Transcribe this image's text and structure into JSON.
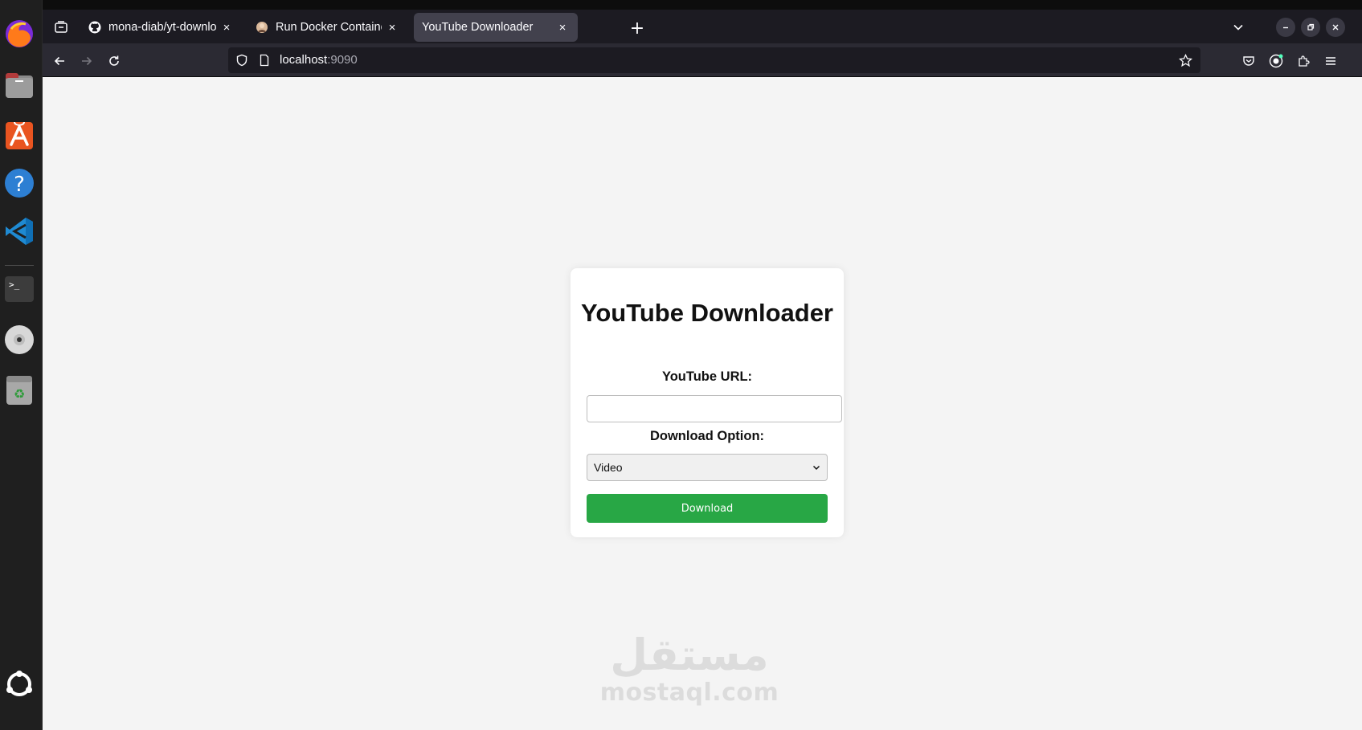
{
  "browser": {
    "tabs": [
      {
        "title": "mona-diab/yt-downloader",
        "favicon": "github-icon",
        "active": false
      },
      {
        "title": "Run Docker Container Co",
        "favicon": "docker-avatar-icon",
        "active": false
      },
      {
        "title": "YouTube Downloader",
        "favicon": "",
        "active": true
      }
    ],
    "new_tab_label": "+",
    "close_glyph": "×",
    "url": {
      "host": "localhost",
      "port": ":9090"
    }
  },
  "dock": {
    "items": [
      "firefox-icon",
      "files-icon",
      "app-center-icon",
      "help-icon",
      "vscode-icon",
      "terminal-icon",
      "disc-icon",
      "trash-icon",
      "ubuntu-apps-icon"
    ]
  },
  "app": {
    "title": "YouTube Downloader",
    "url_label": "YouTube URL:",
    "url_value": "",
    "option_label": "Download Option:",
    "option_selected": "Video",
    "download_label": "Download",
    "accent": "#28a745"
  },
  "watermark": {
    "arabic": "مستقل",
    "latin": "mostaql.com"
  }
}
